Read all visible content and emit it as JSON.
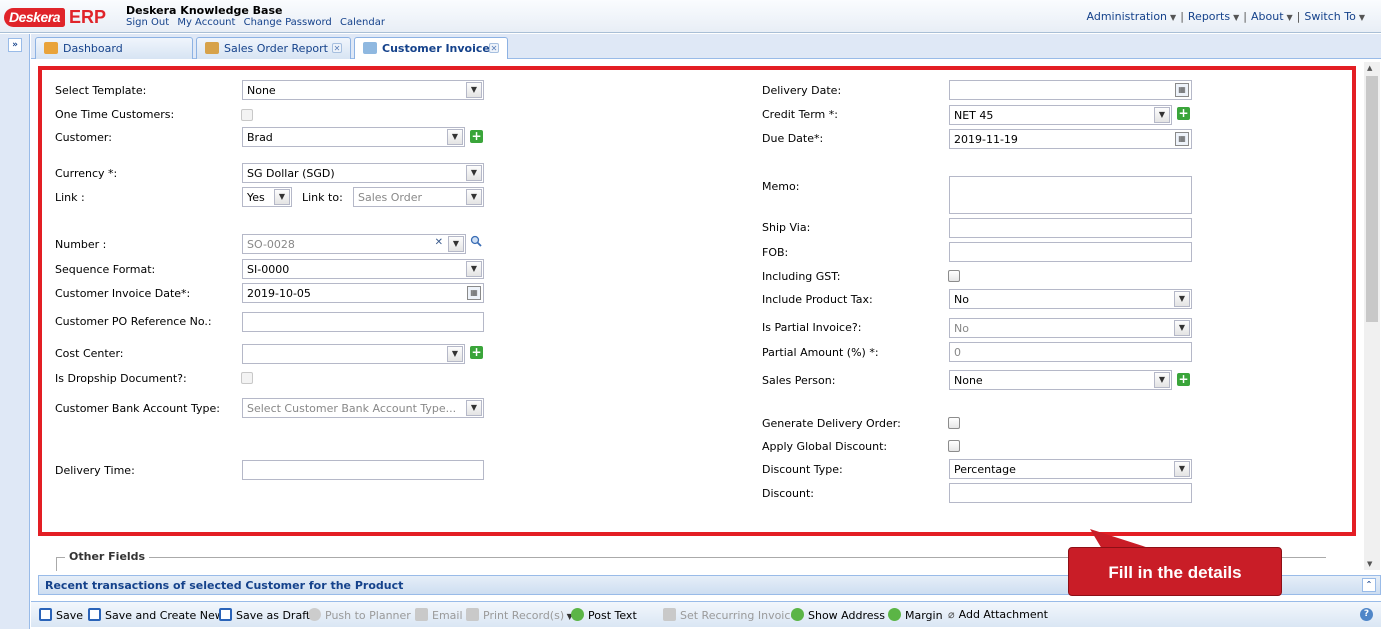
{
  "header": {
    "logo_text": "Deskera",
    "erp_text": "ERP",
    "title": "Deskera Knowledge Base",
    "links": [
      "Sign Out",
      "My Account",
      "Change Password",
      "Calendar"
    ],
    "menu": [
      "Administration",
      "Reports",
      "About",
      "Switch To"
    ]
  },
  "tabs": [
    {
      "label": "Dashboard"
    },
    {
      "label": "Sales Order Report"
    },
    {
      "label": "Customer Invoice"
    }
  ],
  "form": {
    "left": {
      "select_template": {
        "label": "Select Template:",
        "value": "None"
      },
      "one_time_customers": {
        "label": "One Time Customers:"
      },
      "customer": {
        "label": "Customer:",
        "value": "Brad"
      },
      "currency": {
        "label": "Currency *:",
        "value": "SG Dollar (SGD)"
      },
      "link": {
        "label": "Link :",
        "value": "Yes"
      },
      "link_to": {
        "label": "Link to:",
        "placeholder": "Sales Order"
      },
      "number": {
        "label": "Number :",
        "value": "SO-0028"
      },
      "sequence_format": {
        "label": "Sequence Format:",
        "value": "SI-0000"
      },
      "invoice_date": {
        "label": "Customer Invoice Date*:",
        "value": "2019-10-05"
      },
      "po_ref": {
        "label": "Customer PO Reference No.:",
        "value": ""
      },
      "cost_center": {
        "label": "Cost Center:",
        "value": ""
      },
      "dropship": {
        "label": "Is Dropship Document?:"
      },
      "bank_account_type": {
        "label": "Customer Bank Account Type:",
        "placeholder": "Select Customer Bank Account Type..."
      },
      "delivery_time": {
        "label": "Delivery Time:",
        "value": ""
      }
    },
    "right": {
      "delivery_date": {
        "label": "Delivery Date:",
        "value": ""
      },
      "credit_term": {
        "label": "Credit Term *:",
        "value": "NET 45"
      },
      "due_date": {
        "label": "Due Date*:",
        "value": "2019-11-19"
      },
      "memo": {
        "label": "Memo:",
        "value": ""
      },
      "ship_via": {
        "label": "Ship Via:",
        "value": ""
      },
      "fob": {
        "label": "FOB:",
        "value": ""
      },
      "including_gst": {
        "label": "Including GST:"
      },
      "include_product_tax": {
        "label": "Include Product Tax:",
        "value": "No"
      },
      "is_partial_invoice": {
        "label": "Is Partial Invoice?:",
        "value": "No"
      },
      "partial_amount": {
        "label": "Partial Amount (%) *:",
        "value": "0"
      },
      "sales_person": {
        "label": "Sales Person:",
        "value": "None"
      },
      "generate_delivery_order": {
        "label": "Generate Delivery Order:"
      },
      "apply_global_discount": {
        "label": "Apply Global Discount:"
      },
      "discount_type": {
        "label": "Discount Type:",
        "value": "Percentage"
      },
      "discount": {
        "label": "Discount:",
        "value": ""
      }
    }
  },
  "other_fields_title": "Other Fields",
  "recent_bar": "Recent transactions of selected Customer for the Product",
  "toolbar": {
    "save": "Save",
    "save_create_new": "Save and Create New",
    "save_draft": "Save as Draft",
    "push_planner": "Push to Planner",
    "email": "Email",
    "print": "Print Record(s)",
    "post_text": "Post Text",
    "set_recurring": "Set Recurring Invoice",
    "show_address": "Show Address",
    "margin": "Margin",
    "add_attachment": "Add Attachment"
  },
  "callout": "Fill in the details",
  "colors": {
    "highlight": "#e31e24",
    "callout": "#c91d27",
    "accent": "#15428b"
  }
}
